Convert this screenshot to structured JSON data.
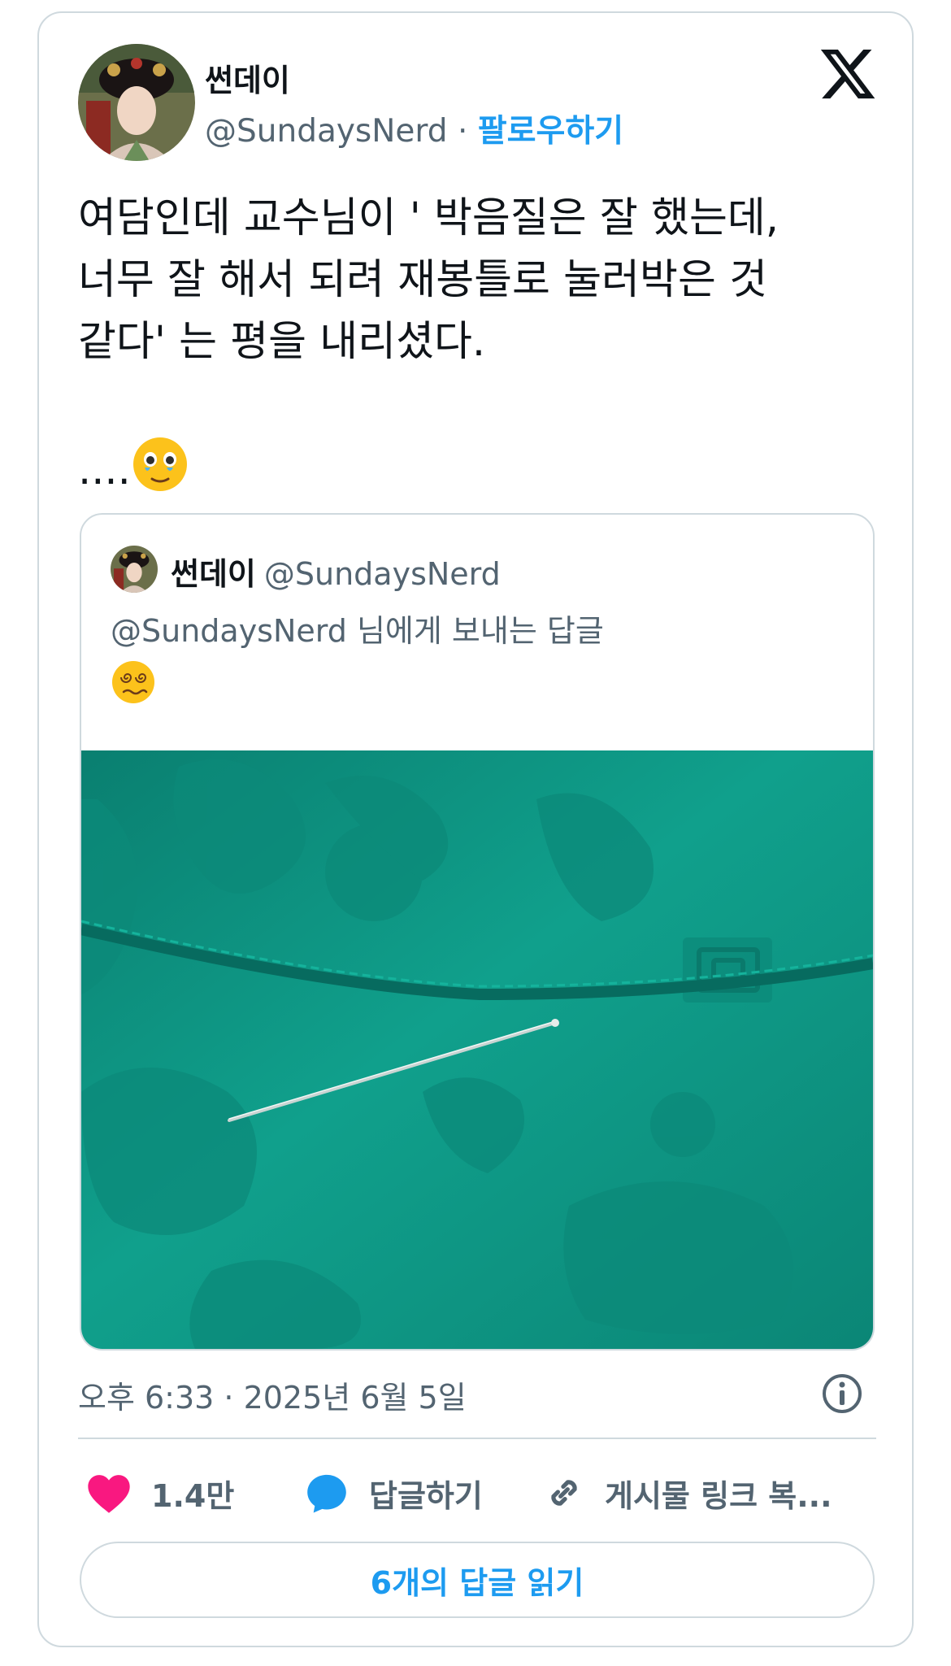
{
  "author": {
    "display_name": "썬데이",
    "handle": "@SundaysNerd",
    "separator": "·",
    "follow_label": "팔로우하기"
  },
  "tweet": {
    "text": "여담인데 교수님이 ' 박음질은 잘 했는데,\n너무 잘 해서 되려 재봉틀로 눌러박은 것\n같다' 는 평을 내리셨다.\n\n....",
    "trailing_emoji": "face-holding-back-tears-icon",
    "timestamp": "오후 6:33 · 2025년 6월 5일"
  },
  "quote": {
    "display_name": "썬데이",
    "handle": "@SundaysNerd",
    "reply_context": "@SundaysNerd 님에게 보내는 답글",
    "emoji": "face-with-spiral-eyes-icon",
    "image_subject": "teal jacquard fabric with seam and sewing pin"
  },
  "actions": {
    "like_count": "1.4만",
    "reply_label": "답글하기",
    "copy_link_label": "게시물 링크 복..."
  },
  "read_replies_label": "6개의 답글 읽기",
  "colors": {
    "accent": "#1d9bf0",
    "like": "#f91880",
    "text_primary": "#0f1419",
    "text_secondary": "#536471",
    "border": "#cfd9de",
    "fabric": "#0e9a86"
  }
}
